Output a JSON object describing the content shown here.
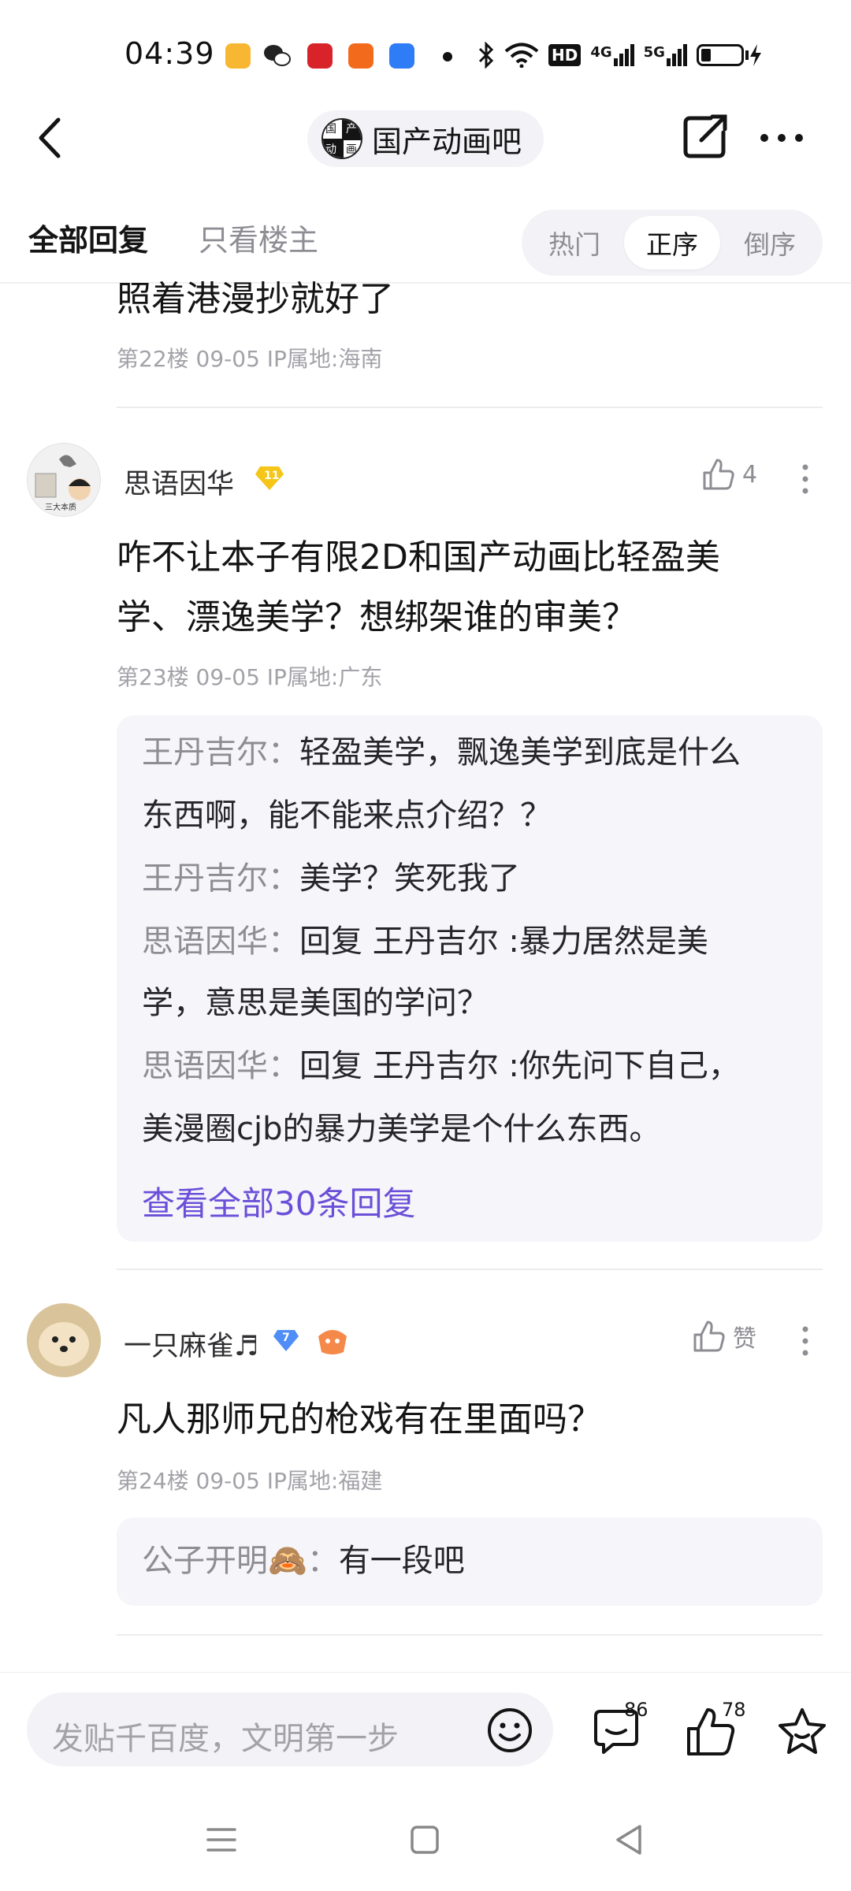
{
  "status_bar": {
    "time": "04:39",
    "network_5g": "5G",
    "network_4g": "4G",
    "hd": "HD"
  },
  "header": {
    "forum_name": "国产动画吧",
    "forum_logo_chars": [
      "国",
      "产",
      "动",
      "画"
    ]
  },
  "tabs": {
    "all_replies": "全部回复",
    "op_only": "只看楼主",
    "sort": [
      "热门",
      "正序",
      "倒序"
    ]
  },
  "posts": [
    {
      "text": "照着港漫抄就好了",
      "meta": "第22楼  09-05  IP属地:海南"
    },
    {
      "username": "思语因华",
      "level": "11",
      "likes": "4",
      "text": [
        "咋不让本子有限2D和国产动画比轻盈美",
        "学、漂逸美学？想绑架谁的审美？"
      ],
      "meta": "第23楼  09-05  IP属地:广东",
      "avatar_caption": "三大本质",
      "replies": [
        {
          "name": "王丹吉尔",
          "sep": "：",
          "text": "轻盈美学，飘逸美学到底是什么"
        },
        {
          "name": "",
          "sep": "",
          "text": "东西啊，能不能来点介绍？？"
        },
        {
          "name": "王丹吉尔",
          "sep": "：",
          "text": "美学？笑死我了"
        },
        {
          "name": "思语因华",
          "sep": "：",
          "text": "回复 王丹吉尔 :暴力居然是美"
        },
        {
          "name": "",
          "sep": "",
          "text": "学，意思是美国的学问？"
        },
        {
          "name": "思语因华",
          "sep": "：",
          "text": "回复 王丹吉尔 :你先问下自己，"
        },
        {
          "name": "",
          "sep": "",
          "text": "美漫圈cjb的暴力美学是个什么东西。"
        }
      ],
      "view_all": "查看全部30条回复"
    },
    {
      "username": "一只麻雀♬",
      "level": "7",
      "likes": "赞",
      "text": "凡人那师兄的枪戏有在里面吗？",
      "meta": "第24楼  09-05  IP属地:福建",
      "replies": [
        {
          "name": "公子开明🙈",
          "sep": "：",
          "text": "有一段吧"
        }
      ]
    }
  ],
  "bottom_bar": {
    "input_placeholder": "发贴千百度，文明第一步",
    "comment_count": "86",
    "like_count": "78"
  },
  "colors": {
    "accent_purple": "#6b4fd8",
    "gold_badge": "#f5c518",
    "blue_badge": "#4f8ef7"
  }
}
